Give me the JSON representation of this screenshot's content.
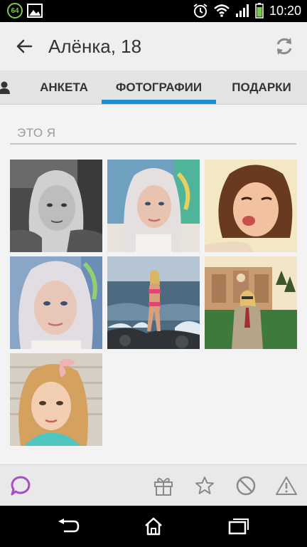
{
  "status_bar": {
    "badge": "64",
    "time": "10:20",
    "icons": [
      "notification-64-icon",
      "image-icon",
      "alarm-icon",
      "wifi-icon",
      "signal-icon",
      "battery-icon"
    ]
  },
  "app_bar": {
    "title": "Алёнка, 18",
    "back_icon": "arrow-back-icon",
    "refresh_icon": "refresh-icon"
  },
  "tabs": [
    {
      "label": "АНКЕТА",
      "selected": false
    },
    {
      "label": "ФОТОГРАФИИ",
      "selected": true
    },
    {
      "label": "ПОДАРКИ",
      "selected": false
    }
  ],
  "accent_color": "#1a8fd6",
  "section": {
    "title": "ЭТО Я"
  },
  "photos": [
    {
      "name": "photo-1",
      "desc": "black-and-white portrait"
    },
    {
      "name": "photo-2",
      "desc": "blonde portrait"
    },
    {
      "name": "photo-3",
      "desc": "kiss selfie"
    },
    {
      "name": "photo-4",
      "desc": "blonde close-up"
    },
    {
      "name": "photo-5",
      "desc": "beach on rocks"
    },
    {
      "name": "photo-6",
      "desc": "in front of building"
    },
    {
      "name": "photo-7",
      "desc": "portrait with bow"
    }
  ],
  "actions": {
    "chat_icon": "chat-bubble-icon",
    "chat_color": "#a64fc4",
    "gift_icon": "gift-icon",
    "star_icon": "star-icon",
    "block_icon": "block-icon",
    "report_icon": "warning-icon"
  },
  "nav_bar": {
    "icons": [
      "back-nav-icon",
      "home-nav-icon",
      "recents-nav-icon"
    ]
  }
}
